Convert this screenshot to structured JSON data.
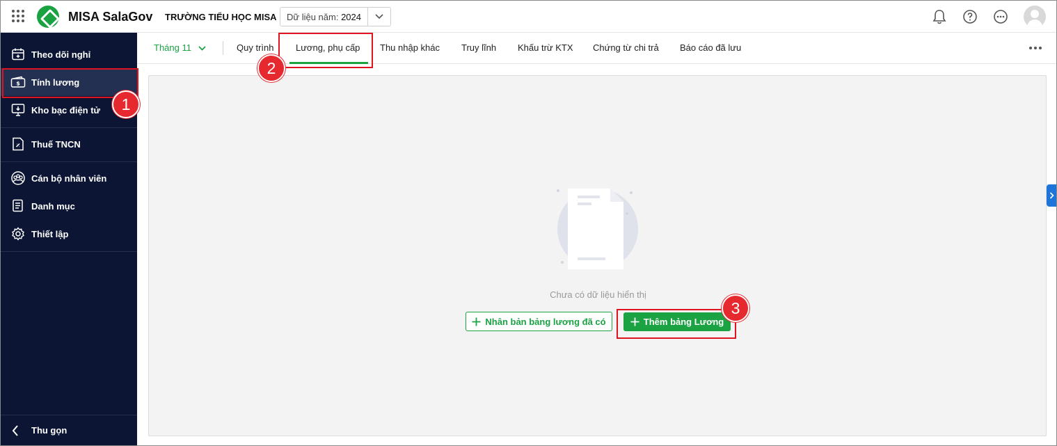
{
  "topbar": {
    "app_title": "MISA SalaGov",
    "school_name": "TRƯỜNG TIỂU HỌC MISA",
    "year_label": "Dữ liệu năm:",
    "year_value": "2024"
  },
  "sidebar": {
    "items": [
      {
        "label": "Theo dõi nghỉ",
        "icon": "calendar-icon"
      },
      {
        "label": "Tính lương",
        "icon": "salary-icon"
      },
      {
        "label": "Kho bạc điện tử",
        "icon": "treasury-icon"
      },
      {
        "label": "Thuế TNCN",
        "icon": "tax-document-icon"
      },
      {
        "label": "Cán bộ nhân viên",
        "icon": "staff-icon"
      },
      {
        "label": "Danh mục",
        "icon": "catalog-icon"
      },
      {
        "label": "Thiết lập",
        "icon": "gear-icon"
      }
    ],
    "active": "Tính lương",
    "collapse_label": "Thu gọn"
  },
  "tabs": {
    "month": "Tháng 11",
    "items": [
      "Quy trình",
      "Lương, phụ cấp",
      "Thu nhập khác",
      "Truy lĩnh",
      "Khấu trừ KTX",
      "Chứng từ chi trả",
      "Báo cáo đã lưu"
    ],
    "active": "Lương, phụ cấp"
  },
  "content": {
    "empty_text": "Chưa có dữ liệu hiển thị",
    "clone_button": "Nhân bản bảng lương đã có",
    "add_button": "Thêm bảng Lương"
  },
  "annotations": {
    "badge_1": "1",
    "badge_2": "2",
    "badge_3": "3",
    "color": "#e0141e"
  },
  "colors": {
    "accent": "#1aa243",
    "sidebar_bg": "#0c1533",
    "sidebar_active": "#243051"
  }
}
